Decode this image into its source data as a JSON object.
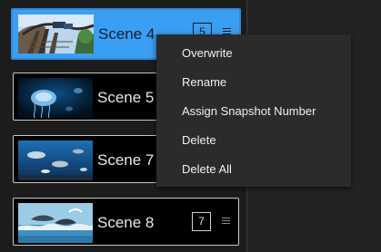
{
  "scenes": [
    {
      "name": "Scene 4",
      "snapshot": "5",
      "selected": true
    },
    {
      "name": "Scene 5",
      "snapshot": "",
      "selected": false
    },
    {
      "name": "Scene 7",
      "snapshot": "",
      "selected": false
    },
    {
      "name": "Scene 8",
      "snapshot": "7",
      "selected": false
    }
  ],
  "context_menu": {
    "items": [
      "Overwrite",
      "Rename",
      "Assign Snapshot Number",
      "Delete",
      "Delete All"
    ]
  },
  "colors": {
    "selected_bg": "#3a9ef2",
    "panel_bg": "#1c1c1c",
    "menu_bg": "#2b2b2b"
  },
  "icons": {
    "drag_handle": "drag-handle-icon"
  }
}
